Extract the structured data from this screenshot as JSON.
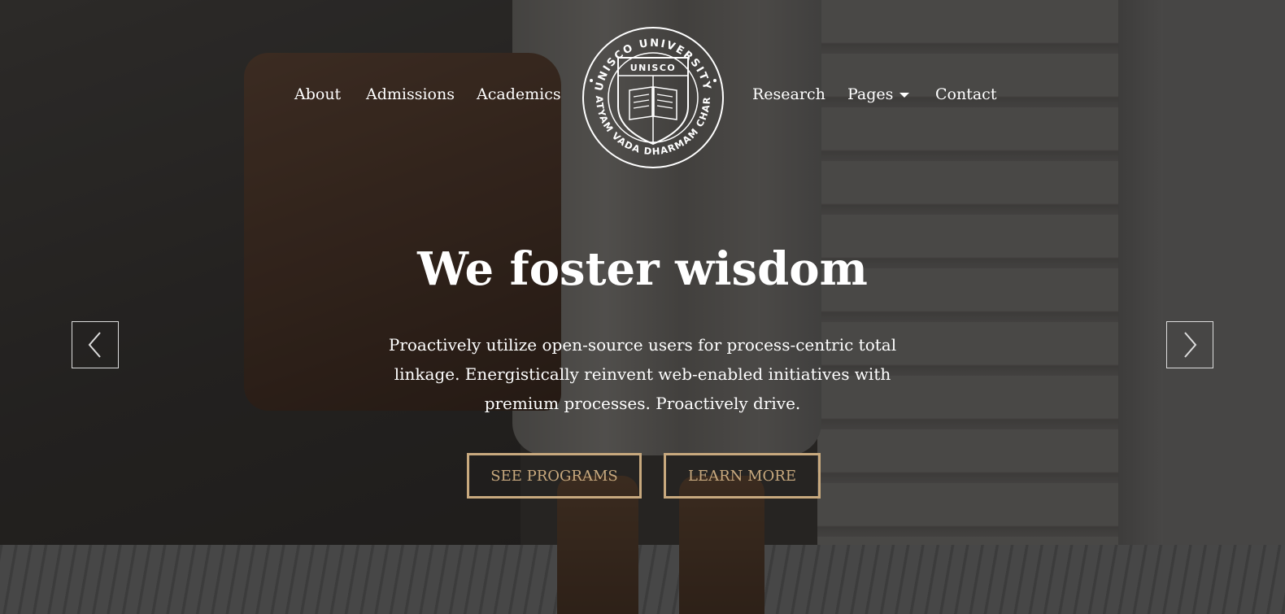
{
  "nav": {
    "left": [
      "About",
      "Admissions",
      "Academics"
    ],
    "right": [
      "Research",
      "Pages",
      "Contact"
    ]
  },
  "logo": {
    "top_text": "UNISCO UNIVERSITY",
    "bottom_text": "SATYAM VADA DHARMAM CHARA",
    "shield_text": "UNISCO"
  },
  "hero": {
    "title": "We foster wisdom",
    "description": "Proactively utilize open-source users for process-centric total linkage. Energistically reinvent web-enabled initiatives with premium processes. Proactively drive.",
    "buttons": [
      "SEE PROGRAMS",
      "LEARN MORE"
    ]
  },
  "icons": {
    "prev": "chevron-left-icon",
    "next": "chevron-right-icon",
    "dropdown": "caret-down-icon"
  },
  "colors": {
    "accent": "#c8a97e",
    "text": "#ffffff"
  }
}
